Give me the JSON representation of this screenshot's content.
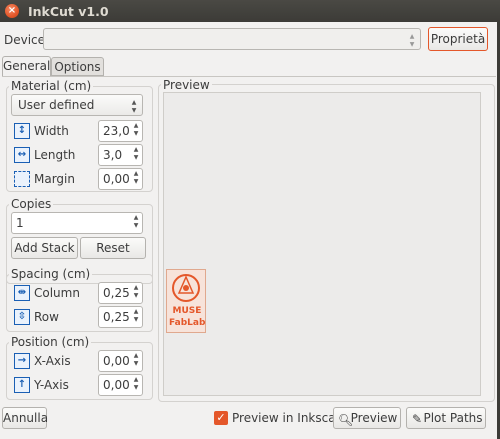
{
  "window": {
    "title": "InkCut v1.0",
    "close_glyph": "×"
  },
  "device": {
    "label": "Device",
    "value": "",
    "properties_button": "Proprietà"
  },
  "tabs": [
    {
      "label": "General",
      "active": true
    },
    {
      "label": "Options",
      "active": false
    }
  ],
  "material": {
    "title": "Material (cm)",
    "select_value": "User defined",
    "fields": [
      {
        "label": "Width",
        "value": "23,0",
        "icon": "width-arrows-icon"
      },
      {
        "label": "Length",
        "value": "3,0",
        "icon": "length-arrows-icon"
      },
      {
        "label": "Margin",
        "value": "0,00",
        "icon": "margin-frame-icon"
      }
    ]
  },
  "copies": {
    "title": "Copies",
    "value": "1",
    "add_stack": "Add Stack",
    "reset": "Reset"
  },
  "spacing": {
    "title": "Spacing (cm)",
    "fields": [
      {
        "label": "Column",
        "value": "0,25",
        "icon": "column-spacing-icon"
      },
      {
        "label": "Row",
        "value": "0,25",
        "icon": "row-spacing-icon"
      }
    ]
  },
  "position": {
    "title": "Position (cm)",
    "fields": [
      {
        "label": "X-Axis",
        "value": "0,00",
        "icon": "x-axis-icon"
      },
      {
        "label": "Y-Axis",
        "value": "0,00",
        "icon": "y-axis-icon"
      }
    ]
  },
  "preview": {
    "title": "Preview",
    "logo_line1": "MUSE",
    "logo_line2": "FabLab"
  },
  "footer": {
    "cancel": "Annulla",
    "preview_inkscape_label": "Preview in Inkscape",
    "preview_inkscape_checked": true,
    "preview_button": "Preview",
    "plot_button": "Plot Paths"
  },
  "colors": {
    "accent": "#e4572a",
    "icon_blue": "#1a5fb4",
    "titlebar": "#3c3b37"
  }
}
